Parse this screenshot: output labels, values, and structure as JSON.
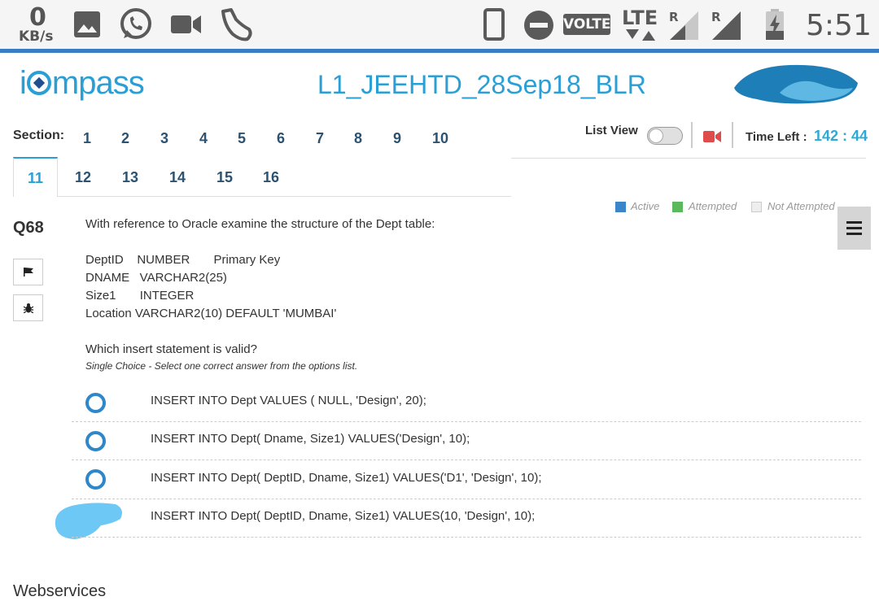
{
  "status_bar": {
    "speed_value": "0",
    "speed_unit": "KB/s",
    "volte": "VOLTE",
    "lte": "LTE",
    "roaming_1": "R",
    "roaming_2": "R",
    "time": "5:51",
    "icons": [
      "gallery-icon",
      "whatsapp-icon",
      "video-camera-icon",
      "shoe-icon",
      "phone-icon",
      "do-not-disturb-icon",
      "signal-icon",
      "battery-charging-icon"
    ]
  },
  "header": {
    "logo_text_left": "i",
    "logo_text_right": "mpass",
    "exam_title": "L1_JEEHTD_28Sep18_BLR"
  },
  "sections": {
    "label": "Section:",
    "row1": [
      "1",
      "2",
      "3",
      "4",
      "5",
      "6",
      "7",
      "8",
      "9",
      "10"
    ],
    "row2": [
      "11",
      "12",
      "13",
      "14",
      "15",
      "16"
    ],
    "active": "11"
  },
  "controls": {
    "list_view_label": "List View",
    "time_left_label": "Time Left :",
    "time_left_value": "142 : 44"
  },
  "legend": {
    "active": "Active",
    "attempted": "Attempted",
    "not_attempted": "Not Attempted",
    "active_color": "#3b85c9",
    "attempted_color": "#5cb85c",
    "not_attempted_color": "#eeeeee"
  },
  "question": {
    "number": "Q68",
    "intro": "With reference to Oracle examine the structure of the Dept table:",
    "structure": [
      "DeptID    NUMBER       Primary Key",
      "DNAME   VARCHAR2(25)",
      "Size1       INTEGER",
      "Location VARCHAR2(10) DEFAULT 'MUMBAI'"
    ],
    "prompt": "Which insert statement is valid?",
    "hint": "Single Choice - Select one correct answer from the options list."
  },
  "options": [
    "INSERT INTO Dept VALUES ( NULL, 'Design', 20);",
    "INSERT INTO Dept( Dname, Size1) VALUES('Design', 10);",
    "INSERT INTO Dept( DeptID, Dname, Size1) VALUES('D1', 'Design', 10);",
    "INSERT INTO Dept( DeptID, Dname, Size1) VALUES(10, 'Design', 10);"
  ],
  "footer": {
    "text": "Webservices"
  },
  "colors": {
    "accent": "#2a9fd6",
    "radio": "#2f86c8",
    "section_text": "#2c5271"
  }
}
